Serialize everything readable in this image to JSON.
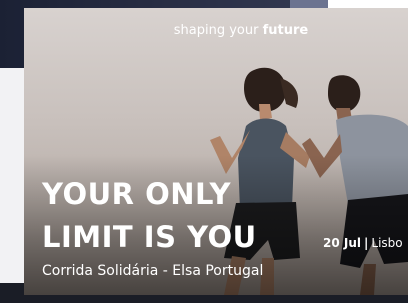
{
  "banner": {
    "tagline_prefix": "shaping your ",
    "tagline_bold": "future",
    "headline_line1": "YOUR ONLY",
    "headline_line2": "LIMIT IS YOU",
    "date": "20 Jul",
    "separator": "|",
    "location": "Lisbo",
    "subtitle": "Corrida Solidária - Elsa Portugal"
  }
}
